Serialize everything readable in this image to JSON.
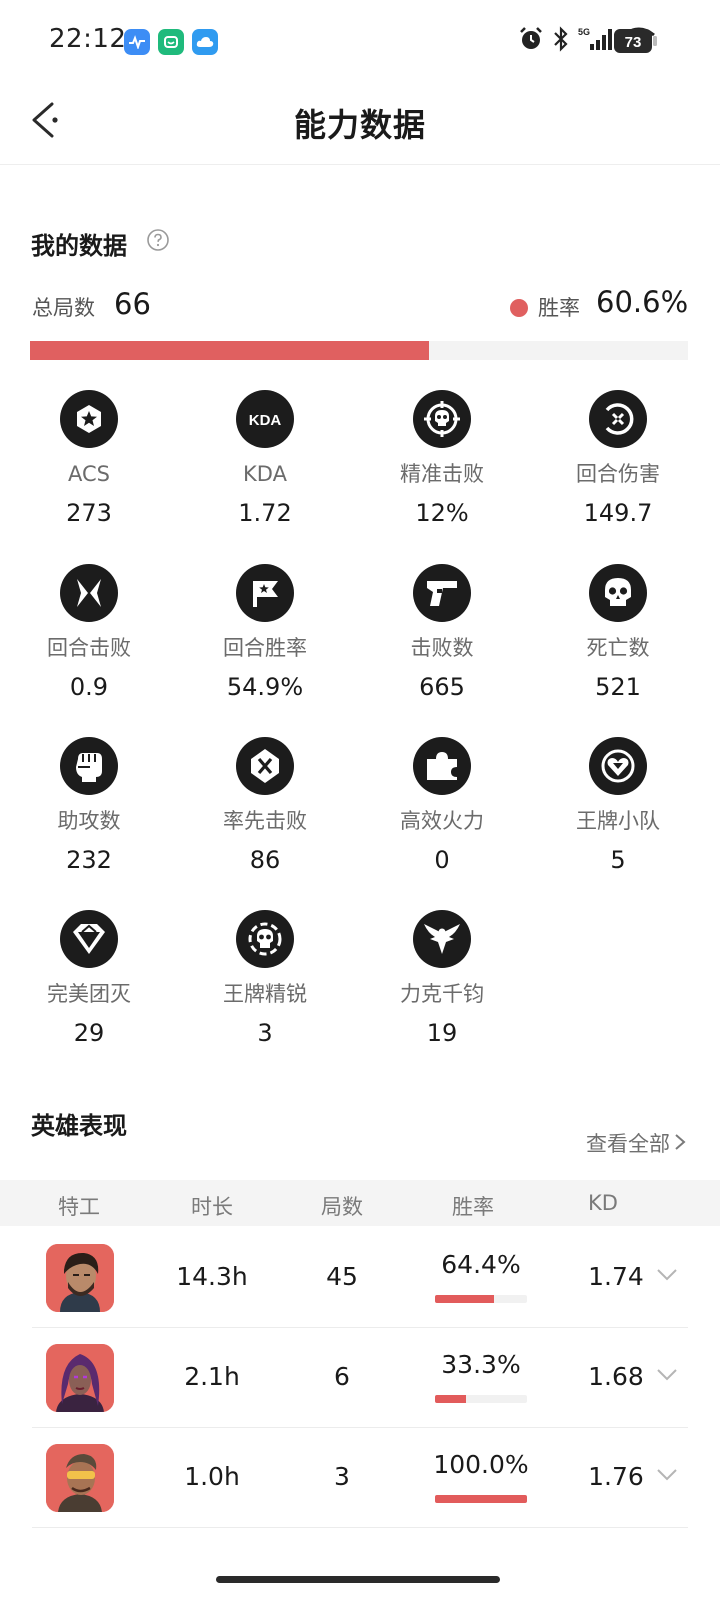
{
  "status_bar": {
    "time": "22:12",
    "battery": "73",
    "network": "5G",
    "notification_icons": [
      "health-app-icon",
      "mi-home-icon",
      "cloud-icon"
    ],
    "system_icons": [
      "alarm-icon",
      "bluetooth-icon",
      "signal-icon",
      "wifi-icon",
      "battery-icon"
    ]
  },
  "header": {
    "title": "能力数据"
  },
  "my_data": {
    "title": "我的数据",
    "total_label": "总局数",
    "total_value": "66",
    "win_label": "胜率",
    "win_value": "60.6%",
    "win_fraction": 0.606,
    "accent_color": "#e06060"
  },
  "stats": [
    {
      "label": "ACS",
      "value": "273",
      "icon": "star-hex-icon"
    },
    {
      "label": "KDA",
      "value": "1.72",
      "icon": "kda-icon"
    },
    {
      "label": "精准击败",
      "value": "12%",
      "icon": "crosshair-skull-icon"
    },
    {
      "label": "回合伤害",
      "value": "149.7",
      "icon": "damage-icon"
    },
    {
      "label": "回合击败",
      "value": "0.9",
      "icon": "crossed-blades-icon"
    },
    {
      "label": "回合胜率",
      "value": "54.9%",
      "icon": "flag-star-icon"
    },
    {
      "label": "击败数",
      "value": "665",
      "icon": "pistol-icon"
    },
    {
      "label": "死亡数",
      "value": "521",
      "icon": "skull-icon"
    },
    {
      "label": "助攻数",
      "value": "232",
      "icon": "fist-icon"
    },
    {
      "label": "率先击败",
      "value": "86",
      "icon": "first-blood-icon"
    },
    {
      "label": "高效火力",
      "value": "0",
      "icon": "puzzle-icon"
    },
    {
      "label": "王牌小队",
      "value": "5",
      "icon": "heart-shield-icon"
    },
    {
      "label": "完美团灭",
      "value": "29",
      "icon": "diamond-icon"
    },
    {
      "label": "王牌精锐",
      "value": "3",
      "icon": "elite-skull-icon"
    },
    {
      "label": "力克千钧",
      "value": "19",
      "icon": "eagle-icon"
    }
  ],
  "heroes": {
    "title": "英雄表现",
    "view_all": "查看全部",
    "columns": [
      "特工",
      "时长",
      "局数",
      "胜率",
      "KD"
    ],
    "rows": [
      {
        "time": "14.3h",
        "games": "45",
        "winrate": "64.4%",
        "win_fraction": 0.644,
        "kd": "1.74",
        "avatar": "agent-portrait-bearded"
      },
      {
        "time": "2.1h",
        "games": "6",
        "winrate": "33.3%",
        "win_fraction": 0.333,
        "kd": "1.68",
        "avatar": "agent-portrait-purple-hair"
      },
      {
        "time": "1.0h",
        "games": "3",
        "winrate": "100.0%",
        "win_fraction": 1.0,
        "kd": "1.76",
        "avatar": "agent-portrait-sunglasses"
      }
    ]
  }
}
